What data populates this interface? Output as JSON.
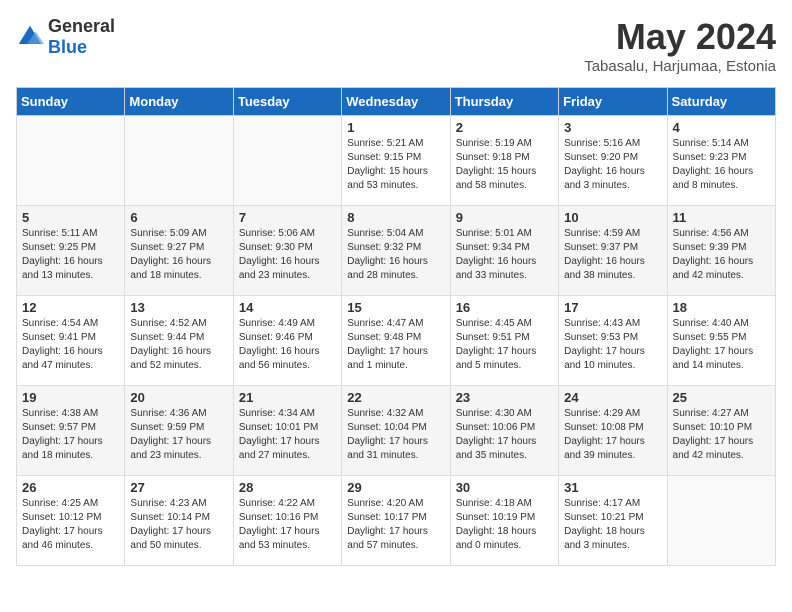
{
  "logo": {
    "general": "General",
    "blue": "Blue"
  },
  "title": "May 2024",
  "location": "Tabasalu, Harjumaa, Estonia",
  "days_header": [
    "Sunday",
    "Monday",
    "Tuesday",
    "Wednesday",
    "Thursday",
    "Friday",
    "Saturday"
  ],
  "weeks": [
    [
      {
        "num": "",
        "info": ""
      },
      {
        "num": "",
        "info": ""
      },
      {
        "num": "",
        "info": ""
      },
      {
        "num": "1",
        "info": "Sunrise: 5:21 AM\nSunset: 9:15 PM\nDaylight: 15 hours\nand 53 minutes."
      },
      {
        "num": "2",
        "info": "Sunrise: 5:19 AM\nSunset: 9:18 PM\nDaylight: 15 hours\nand 58 minutes."
      },
      {
        "num": "3",
        "info": "Sunrise: 5:16 AM\nSunset: 9:20 PM\nDaylight: 16 hours\nand 3 minutes."
      },
      {
        "num": "4",
        "info": "Sunrise: 5:14 AM\nSunset: 9:23 PM\nDaylight: 16 hours\nand 8 minutes."
      }
    ],
    [
      {
        "num": "5",
        "info": "Sunrise: 5:11 AM\nSunset: 9:25 PM\nDaylight: 16 hours\nand 13 minutes."
      },
      {
        "num": "6",
        "info": "Sunrise: 5:09 AM\nSunset: 9:27 PM\nDaylight: 16 hours\nand 18 minutes."
      },
      {
        "num": "7",
        "info": "Sunrise: 5:06 AM\nSunset: 9:30 PM\nDaylight: 16 hours\nand 23 minutes."
      },
      {
        "num": "8",
        "info": "Sunrise: 5:04 AM\nSunset: 9:32 PM\nDaylight: 16 hours\nand 28 minutes."
      },
      {
        "num": "9",
        "info": "Sunrise: 5:01 AM\nSunset: 9:34 PM\nDaylight: 16 hours\nand 33 minutes."
      },
      {
        "num": "10",
        "info": "Sunrise: 4:59 AM\nSunset: 9:37 PM\nDaylight: 16 hours\nand 38 minutes."
      },
      {
        "num": "11",
        "info": "Sunrise: 4:56 AM\nSunset: 9:39 PM\nDaylight: 16 hours\nand 42 minutes."
      }
    ],
    [
      {
        "num": "12",
        "info": "Sunrise: 4:54 AM\nSunset: 9:41 PM\nDaylight: 16 hours\nand 47 minutes."
      },
      {
        "num": "13",
        "info": "Sunrise: 4:52 AM\nSunset: 9:44 PM\nDaylight: 16 hours\nand 52 minutes."
      },
      {
        "num": "14",
        "info": "Sunrise: 4:49 AM\nSunset: 9:46 PM\nDaylight: 16 hours\nand 56 minutes."
      },
      {
        "num": "15",
        "info": "Sunrise: 4:47 AM\nSunset: 9:48 PM\nDaylight: 17 hours\nand 1 minute."
      },
      {
        "num": "16",
        "info": "Sunrise: 4:45 AM\nSunset: 9:51 PM\nDaylight: 17 hours\nand 5 minutes."
      },
      {
        "num": "17",
        "info": "Sunrise: 4:43 AM\nSunset: 9:53 PM\nDaylight: 17 hours\nand 10 minutes."
      },
      {
        "num": "18",
        "info": "Sunrise: 4:40 AM\nSunset: 9:55 PM\nDaylight: 17 hours\nand 14 minutes."
      }
    ],
    [
      {
        "num": "19",
        "info": "Sunrise: 4:38 AM\nSunset: 9:57 PM\nDaylight: 17 hours\nand 18 minutes."
      },
      {
        "num": "20",
        "info": "Sunrise: 4:36 AM\nSunset: 9:59 PM\nDaylight: 17 hours\nand 23 minutes."
      },
      {
        "num": "21",
        "info": "Sunrise: 4:34 AM\nSunset: 10:01 PM\nDaylight: 17 hours\nand 27 minutes."
      },
      {
        "num": "22",
        "info": "Sunrise: 4:32 AM\nSunset: 10:04 PM\nDaylight: 17 hours\nand 31 minutes."
      },
      {
        "num": "23",
        "info": "Sunrise: 4:30 AM\nSunset: 10:06 PM\nDaylight: 17 hours\nand 35 minutes."
      },
      {
        "num": "24",
        "info": "Sunrise: 4:29 AM\nSunset: 10:08 PM\nDaylight: 17 hours\nand 39 minutes."
      },
      {
        "num": "25",
        "info": "Sunrise: 4:27 AM\nSunset: 10:10 PM\nDaylight: 17 hours\nand 42 minutes."
      }
    ],
    [
      {
        "num": "26",
        "info": "Sunrise: 4:25 AM\nSunset: 10:12 PM\nDaylight: 17 hours\nand 46 minutes."
      },
      {
        "num": "27",
        "info": "Sunrise: 4:23 AM\nSunset: 10:14 PM\nDaylight: 17 hours\nand 50 minutes."
      },
      {
        "num": "28",
        "info": "Sunrise: 4:22 AM\nSunset: 10:16 PM\nDaylight: 17 hours\nand 53 minutes."
      },
      {
        "num": "29",
        "info": "Sunrise: 4:20 AM\nSunset: 10:17 PM\nDaylight: 17 hours\nand 57 minutes."
      },
      {
        "num": "30",
        "info": "Sunrise: 4:18 AM\nSunset: 10:19 PM\nDaylight: 18 hours\nand 0 minutes."
      },
      {
        "num": "31",
        "info": "Sunrise: 4:17 AM\nSunset: 10:21 PM\nDaylight: 18 hours\nand 3 minutes."
      },
      {
        "num": "",
        "info": ""
      }
    ]
  ]
}
